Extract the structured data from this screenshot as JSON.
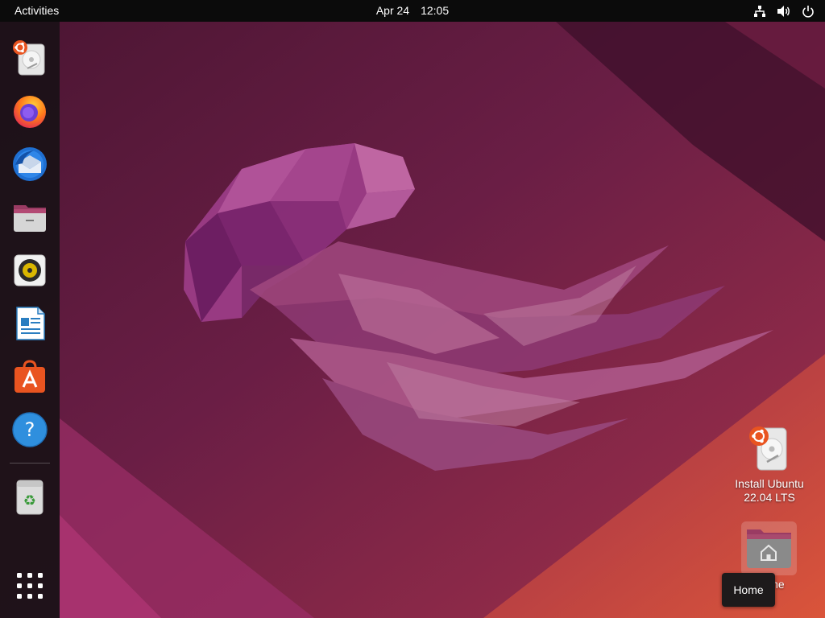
{
  "topbar": {
    "activities_label": "Activities",
    "date": "Apr 24",
    "time": "12:05",
    "tray_icons": [
      "network-icon",
      "volume-icon",
      "power-icon"
    ]
  },
  "dock": {
    "items": [
      {
        "name": "install-ubuntu-icon",
        "app": "Install Ubuntu"
      },
      {
        "name": "firefox-icon",
        "app": "Firefox"
      },
      {
        "name": "thunderbird-icon",
        "app": "Thunderbird"
      },
      {
        "name": "files-icon",
        "app": "Files"
      },
      {
        "name": "rhythmbox-icon",
        "app": "Rhythmbox"
      },
      {
        "name": "libreoffice-writer-icon",
        "app": "LibreOffice Writer"
      },
      {
        "name": "ubuntu-software-icon",
        "app": "Ubuntu Software"
      },
      {
        "name": "help-icon",
        "app": "Help"
      },
      {
        "name": "trash-icon",
        "app": "Trash"
      },
      {
        "name": "show-apps-icon",
        "app": "Show Applications"
      }
    ]
  },
  "desktop": {
    "install_label_line1": "Install Ubuntu",
    "install_label_line2": "22.04 LTS",
    "home_label": "Home"
  },
  "tooltip": {
    "text": "Home"
  },
  "colors": {
    "topbar": "#0b0b0b",
    "dock": "#1c1218",
    "wallpaper_base": "#5a1a3c",
    "accent_orange": "#e95420"
  }
}
